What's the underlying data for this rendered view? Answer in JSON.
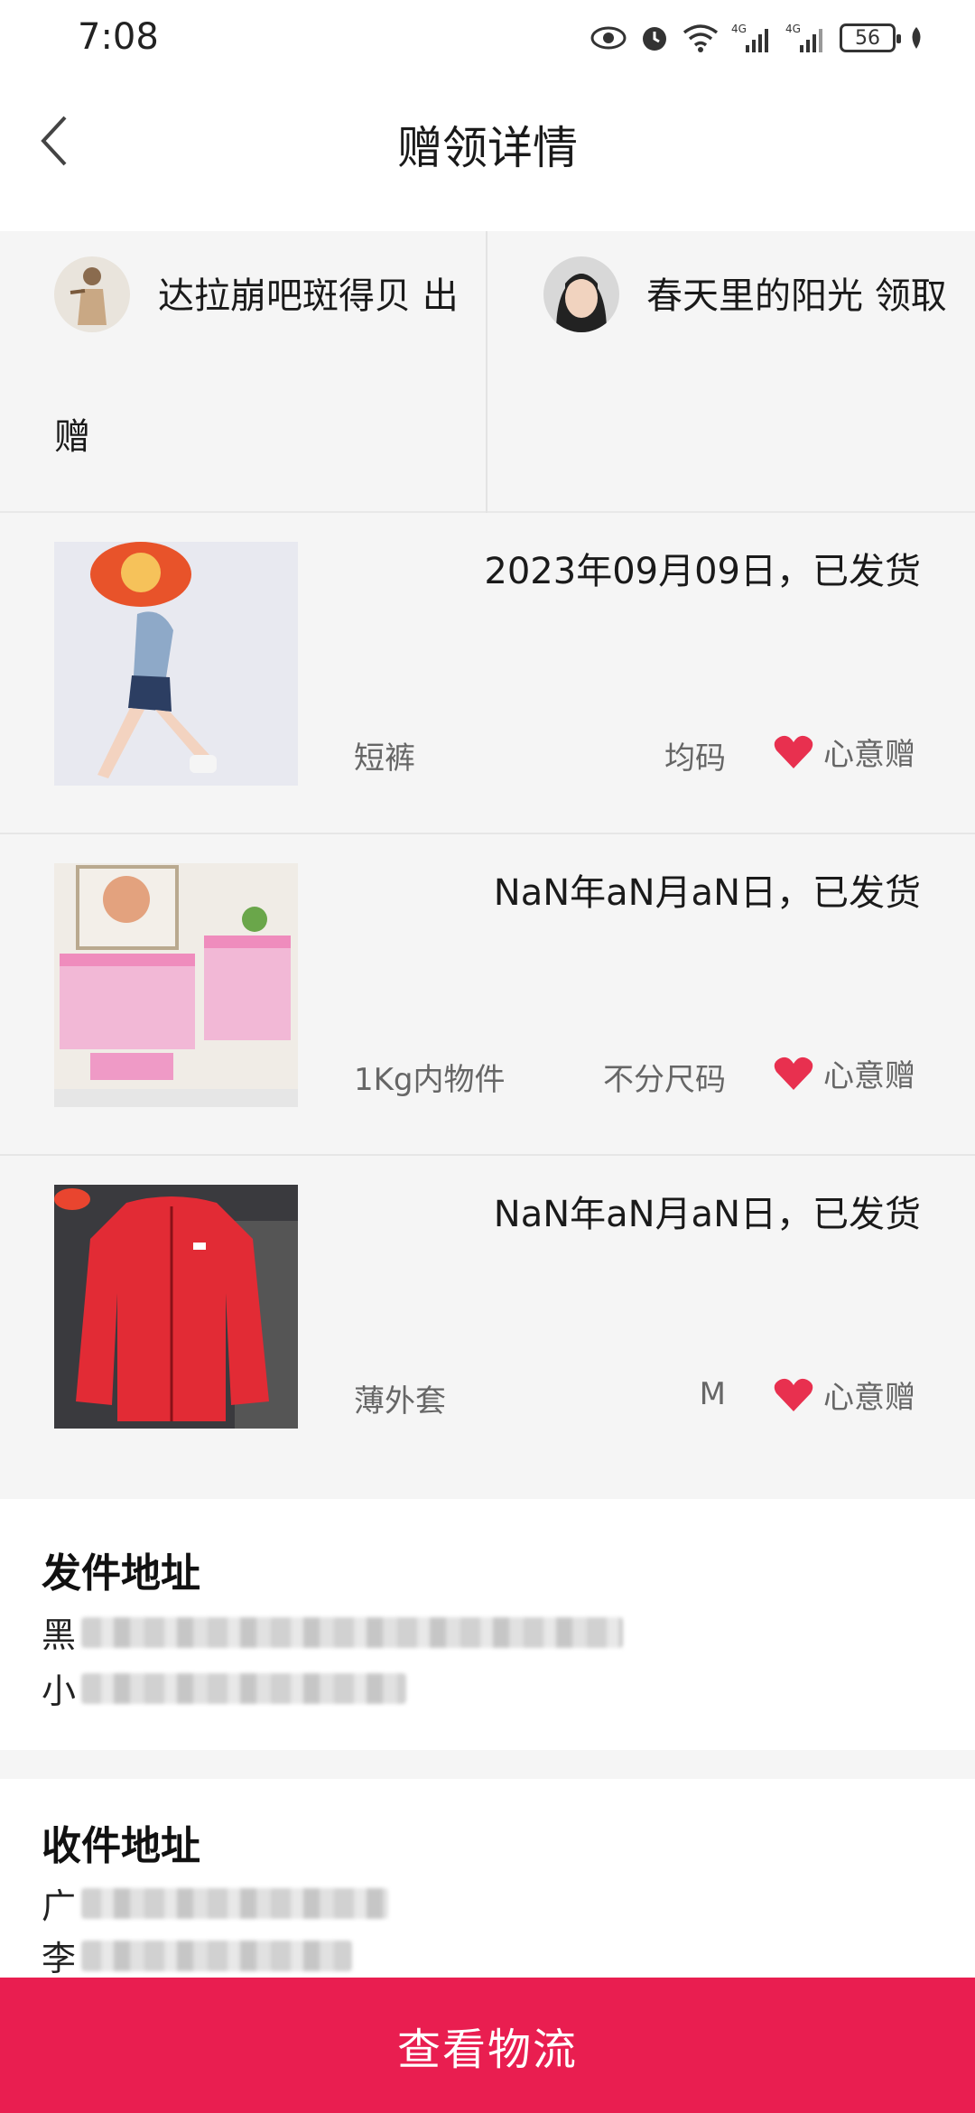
{
  "status_bar": {
    "time": "7:08",
    "battery": "56",
    "net1": "4G",
    "net2": "4G"
  },
  "nav": {
    "title": "赠领详情"
  },
  "people": {
    "giver": "达拉崩吧斑得贝 出赠",
    "receiver": "春天里的阳光 领取"
  },
  "items": [
    {
      "date": "2023年09月09日，已发货",
      "category": "短裤",
      "size": "均码",
      "gift_label": "心意赠"
    },
    {
      "date": "NaN年aN月aN日，已发货",
      "category": "1Kg内物件",
      "size": "不分尺码",
      "gift_label": "心意赠"
    },
    {
      "date": "NaN年aN月aN日，已发货",
      "category": "薄外套",
      "size": "M",
      "gift_label": "心意赠"
    }
  ],
  "from_address": {
    "label": "发件地址",
    "line1_prefix": "黑",
    "line2_prefix": "小"
  },
  "to_address": {
    "label": "收件地址",
    "line1_prefix": "广",
    "line2_prefix": "李"
  },
  "bottom_button": {
    "label": "查看物流",
    "color": "#e91e50"
  },
  "colors": {
    "heart": "#e8304f",
    "background_gray": "#f5f5f5"
  }
}
